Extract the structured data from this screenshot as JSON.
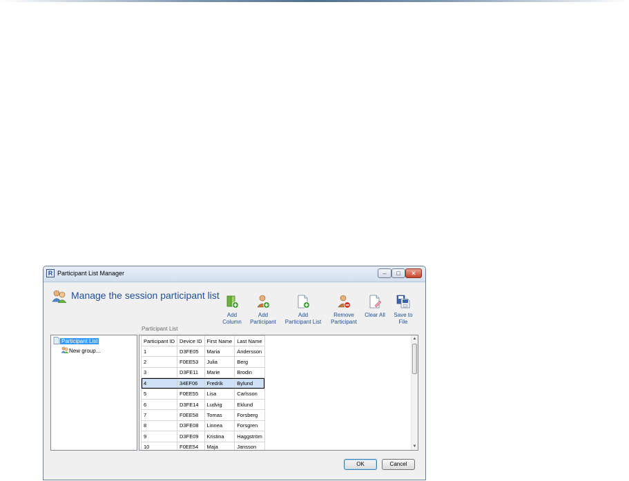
{
  "window": {
    "title": "Participant List Manager",
    "app_icon_letter": "R",
    "min_glyph": "–",
    "max_glyph": "□",
    "close_glyph": "✕"
  },
  "header": {
    "title": "Manage the session participant list"
  },
  "toolbar": [
    {
      "label": "Add\nColumn",
      "icon": "add-column-icon"
    },
    {
      "label": "Add\nParticipant",
      "icon": "add-participant-icon"
    },
    {
      "label": "Add\nParticipant List",
      "icon": "add-participant-list-icon"
    },
    {
      "label": "Remove\nParticipant",
      "icon": "remove-participant-icon"
    },
    {
      "label": "Clear All",
      "icon": "clear-all-icon"
    },
    {
      "label": "Save to\nFile",
      "icon": "save-to-file-icon"
    }
  ],
  "grid_caption": "Participant List",
  "tree": {
    "items": [
      {
        "label": "Participant List",
        "icon": "list-document-icon",
        "selected": true
      },
      {
        "label": "New group...",
        "icon": "group-icon",
        "selected": false
      }
    ]
  },
  "table": {
    "columns": [
      "Participant ID",
      "Device ID",
      "First Name",
      "Last Name"
    ],
    "rows": [
      [
        "1",
        "D3FE05",
        "Maria",
        "Andersson"
      ],
      [
        "2",
        "F0EE53",
        "Julia",
        "Berg"
      ],
      [
        "3",
        "D3FE11",
        "Marie",
        "Brodin"
      ],
      [
        "4",
        "34EF06",
        "Fredrik",
        "Bylund"
      ],
      [
        "5",
        "F0EE55",
        "Lisa",
        "Carlsson"
      ],
      [
        "6",
        "D3FE14",
        "Ludvig",
        "Eklund"
      ],
      [
        "7",
        "F0EE58",
        "Tomas",
        "Forsberg"
      ],
      [
        "8",
        "D3FE08",
        "Linnea",
        "Forsgren"
      ],
      [
        "9",
        "D3FE09",
        "Kristina",
        "Haggström"
      ],
      [
        "10",
        "F0EE54",
        "Maja",
        "Jansson"
      ]
    ],
    "selected_row_index": 3
  },
  "buttons": {
    "ok": "OK",
    "cancel": "Cancel"
  },
  "colors": {
    "accent": "#1f4f99",
    "selection": "#3399ff"
  }
}
